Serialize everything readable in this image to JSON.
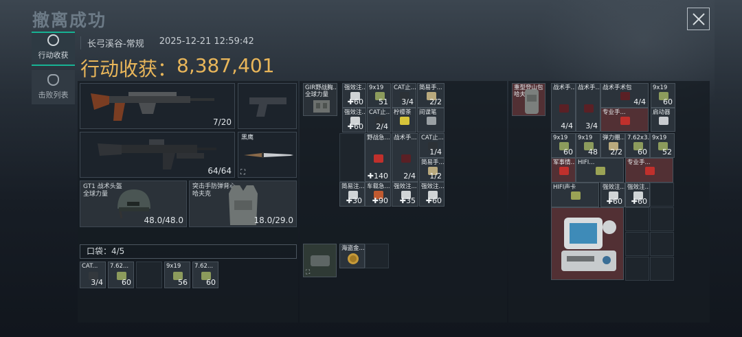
{
  "header": {
    "title": "撤离成功",
    "map": "长弓溪谷-常规",
    "datetime": "2025-12-21 12:59:42",
    "haul_label": "行动收获：",
    "haul_value": "8,387,401"
  },
  "nav": {
    "tab_loot": "行动收获",
    "tab_kills": "击败列表"
  },
  "equip": {
    "primary_ammo": "7/20",
    "secondary_ammo": "64/64",
    "knife_label": "黑鹰",
    "helmet_label": "GT1 战术头盔",
    "helmet_brand": "全球力量",
    "helmet_dur": "48.0/48.0",
    "armor_label": "突击手防弹背心",
    "armor_brand": "哈夫克",
    "armor_dur": "18.0/29.0",
    "pocket": "口袋：4/5"
  },
  "pocket_items": [
    {
      "n": "CAT...",
      "c": "3/4"
    },
    {
      "n": "7.62...",
      "c": "60"
    },
    {
      "n": "",
      "c": ""
    },
    {
      "n": "9x19",
      "c": "56"
    },
    {
      "n": "7.62...",
      "c": "60"
    }
  ],
  "chest": {
    "label": "GIR野战胸...",
    "brand": "全球力量"
  },
  "chest_items": [
    {
      "n": "强效注...",
      "c": "✚60"
    },
    {
      "n": "9x19",
      "c": "51"
    },
    {
      "n": "CAT止...",
      "c": "3/4"
    },
    {
      "n": "简易手...",
      "c": "2/2"
    },
    {
      "n": "强效注...",
      "c": "✚60"
    },
    {
      "n": "CAT止...",
      "c": "2/4"
    },
    {
      "n": "柠檬茶",
      "c": ""
    },
    {
      "n": "间谍笔",
      "c": ""
    },
    {
      "n": "",
      "c": ""
    },
    {
      "n": "野战急...",
      "c": "✚140"
    },
    {
      "n": "战术手...",
      "c": "2/4"
    },
    {
      "n": "CAT止...",
      "c": "1/4"
    },
    {
      "n": "简易手...",
      "c": "1/2"
    },
    {
      "n": "简易注...",
      "c": "✚30"
    },
    {
      "n": "车载急...",
      "c": "✚90"
    },
    {
      "n": "强效注...",
      "c": "✚35"
    },
    {
      "n": "强效注...",
      "c": "✚60"
    }
  ],
  "secure": {
    "label": "",
    "item": "海盗金..."
  },
  "backpack": {
    "label": "重型登山包",
    "brand": "哈夫克"
  },
  "backpack_items": [
    {
      "n": "战术手...",
      "c": "4/4"
    },
    {
      "n": "战术手...",
      "c": "3/4"
    },
    {
      "n": "战术手术包",
      "c": "4/4"
    },
    {
      "n": "9x19",
      "c": "60"
    },
    {
      "n": "专业手...",
      "c": ""
    },
    {
      "n": "启动器",
      "c": ""
    },
    {
      "n": "9x19",
      "c": "60"
    },
    {
      "n": "9x19",
      "c": "48"
    },
    {
      "n": "弹力绷...",
      "c": "2/2"
    },
    {
      "n": "7.62x3...",
      "c": "60"
    },
    {
      "n": "9x19",
      "c": "52"
    },
    {
      "n": "军事情...",
      "c": ""
    },
    {
      "n": "HIFI...",
      "c": ""
    },
    {
      "n": "专业手...",
      "c": ""
    },
    {
      "n": "HIFI声卡",
      "c": ""
    },
    {
      "n": "强效注...",
      "c": "✚60"
    },
    {
      "n": "强效注...",
      "c": "✚60"
    }
  ],
  "colors": {
    "accent": "#17b394",
    "haul": "#e9b65a",
    "rare": "#523034"
  }
}
